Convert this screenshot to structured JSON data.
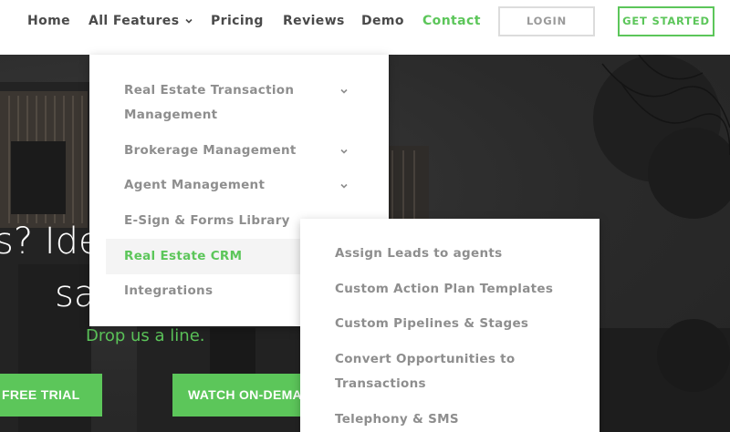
{
  "nav": {
    "home": "Home",
    "all_features": "All Features",
    "pricing": "Pricing",
    "reviews": "Reviews",
    "demo": "Demo",
    "contact": "Contact",
    "login": "LOGIN",
    "get_started": "GET STARTED"
  },
  "features_menu": {
    "items": [
      {
        "line1": "Real Estate Transaction",
        "line2": "Management",
        "has_submenu": true
      },
      {
        "label": "Brokerage Management",
        "has_submenu": true
      },
      {
        "label": "Agent Management",
        "has_submenu": true
      },
      {
        "label": "E-Sign & Forms Library",
        "has_submenu": false
      },
      {
        "label": "Real Estate CRM",
        "has_submenu": false,
        "active": true
      },
      {
        "label": "Integrations",
        "has_submenu": false
      }
    ]
  },
  "crm_submenu": {
    "items": [
      {
        "label": "Assign Leads to agents"
      },
      {
        "label": "Custom Action Plan Templates"
      },
      {
        "label": "Custom Pipelines & Stages"
      },
      {
        "line1": "Convert Opportunities to",
        "line2": "Transactions"
      },
      {
        "label": "Telephony & SMS"
      }
    ]
  },
  "hero": {
    "line1": "s? Ide",
    "line2": "sa",
    "drop_line": "Drop us a line.",
    "cta_trial": "FREE TRIAL",
    "cta_watch": "WATCH ON-DEMAND"
  },
  "colors": {
    "accent": "#5cc65a",
    "nav_text": "#4a4a4a",
    "menu_text": "#8e8e8e",
    "hero_bg": "#2b2b2b"
  }
}
